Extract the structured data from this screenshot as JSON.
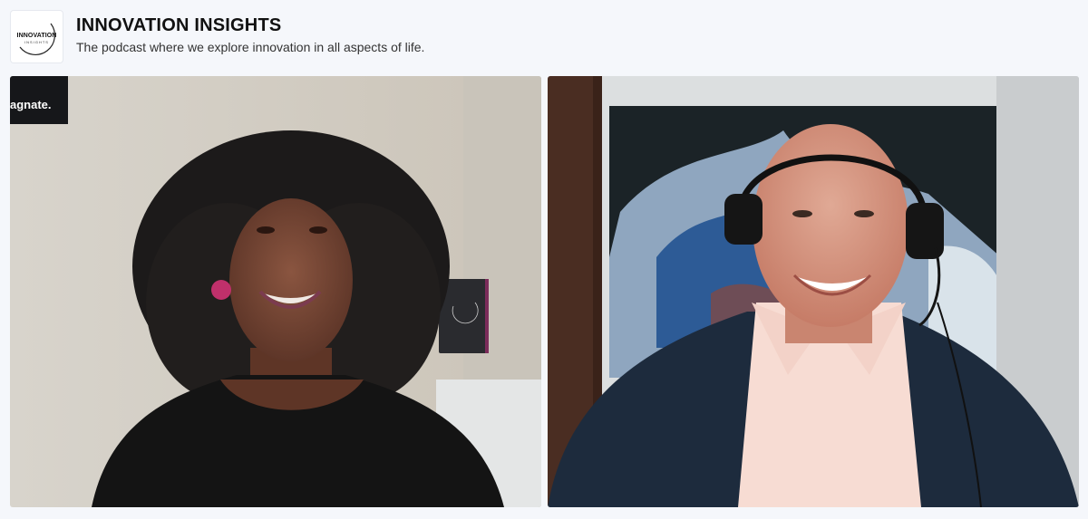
{
  "header": {
    "logo_word": "INNOVATION",
    "logo_sub": "INSIGHTS",
    "title": "INNOVATION INSIGHTS",
    "subtitle": "The podcast where we explore innovation in all aspects of life."
  },
  "participants": [
    {
      "tile": "left",
      "poster_text": "agnate."
    },
    {
      "tile": "right"
    }
  ],
  "colors": {
    "page_bg": "#f5f7fb",
    "title_text": "#111111",
    "subtitle_text": "#333333"
  }
}
